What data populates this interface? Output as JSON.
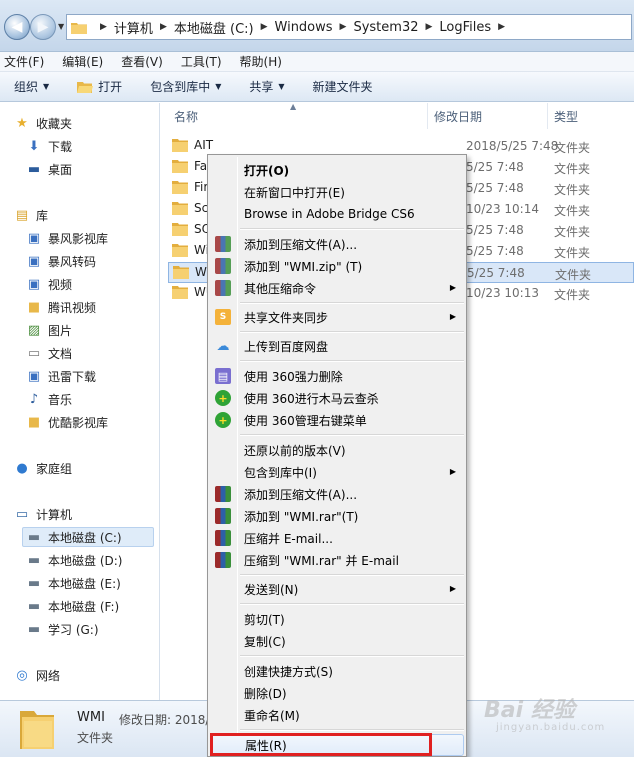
{
  "address": {
    "crumbs": [
      "计算机",
      "本地磁盘 (C:)",
      "Windows",
      "System32",
      "LogFiles"
    ]
  },
  "menubar": [
    "文件(F)",
    "编辑(E)",
    "查看(V)",
    "工具(T)",
    "帮助(H)"
  ],
  "toolbar": {
    "organize": "组织",
    "open": "打开",
    "include_library": "包含到库中",
    "share": "共享",
    "new_folder": "新建文件夹"
  },
  "nav": {
    "favorites": "收藏夹",
    "fav_items": [
      "下载",
      "桌面"
    ],
    "libraries": "库",
    "lib_items": [
      "暴风影视库",
      "暴风转码",
      "视频",
      "腾讯视频",
      "图片",
      "文档",
      "迅雷下载",
      "音乐",
      "优酷影视库"
    ],
    "homegroup": "家庭组",
    "computer": "计算机",
    "drives": [
      "本地磁盘 (C:)",
      "本地磁盘 (D:)",
      "本地磁盘 (E:)",
      "本地磁盘 (F:)",
      "学习 (G:)"
    ],
    "network": "网络"
  },
  "columns": {
    "name": "名称",
    "modified": "修改日期",
    "type": "类型"
  },
  "files": [
    {
      "name": "AIT",
      "date": "2018/5/25 7:48",
      "type": "文件夹"
    },
    {
      "name": "Fa",
      "date": "5/25 7:48",
      "type": "文件夹"
    },
    {
      "name": "Fir",
      "date": "5/25 7:48",
      "type": "文件夹"
    },
    {
      "name": "Sc",
      "date": "10/23 10:14",
      "type": "文件夹"
    },
    {
      "name": "SQ",
      "date": "5/25 7:48",
      "type": "文件夹"
    },
    {
      "name": "Wi",
      "date": "5/25 7:48",
      "type": "文件夹"
    },
    {
      "name": "WI",
      "date": "5/25 7:48",
      "type": "文件夹"
    },
    {
      "name": "WU",
      "date": "10/23 10:13",
      "type": "文件夹"
    }
  ],
  "context_menu": {
    "open": "打开(O)",
    "open_new_window": "在新窗口中打开(E)",
    "adobe_bridge": "Browse in Adobe Bridge CS6",
    "add_archive": "添加到压缩文件(A)...",
    "add_zip": "添加到 \"WMI.zip\" (T)",
    "other_compress": "其他压缩命令",
    "share_sync": "共享文件夹同步",
    "baidu_upload": "上传到百度网盘",
    "force_delete_360": "使用 360强力删除",
    "trojan_scan_360": "使用 360进行木马云查杀",
    "manage_menu_360": "使用 360管理右键菜单",
    "restore_versions": "还原以前的版本(V)",
    "include_library": "包含到库中(I)",
    "add_archive_rar": "添加到压缩文件(A)...",
    "add_rar": "添加到 \"WMI.rar\"(T)",
    "compress_email": "压缩并 E-mail...",
    "compress_rar_email": "压缩到 \"WMI.rar\" 并 E-mail",
    "send_to": "发送到(N)",
    "cut": "剪切(T)",
    "copy": "复制(C)",
    "create_shortcut": "创建快捷方式(S)",
    "delete": "删除(D)",
    "rename": "重命名(M)",
    "properties": "属性(R)"
  },
  "details": {
    "name": "WMI",
    "modified_label": "修改日期: 2018/",
    "type": "文件夹"
  },
  "watermark": {
    "text": "Bai 经验",
    "sub": "jingyan.baidu.com"
  },
  "colors": {
    "selection": "#d9e7f8",
    "highlight_box": "#e02020",
    "menu_bg": "#f0f0f0"
  }
}
